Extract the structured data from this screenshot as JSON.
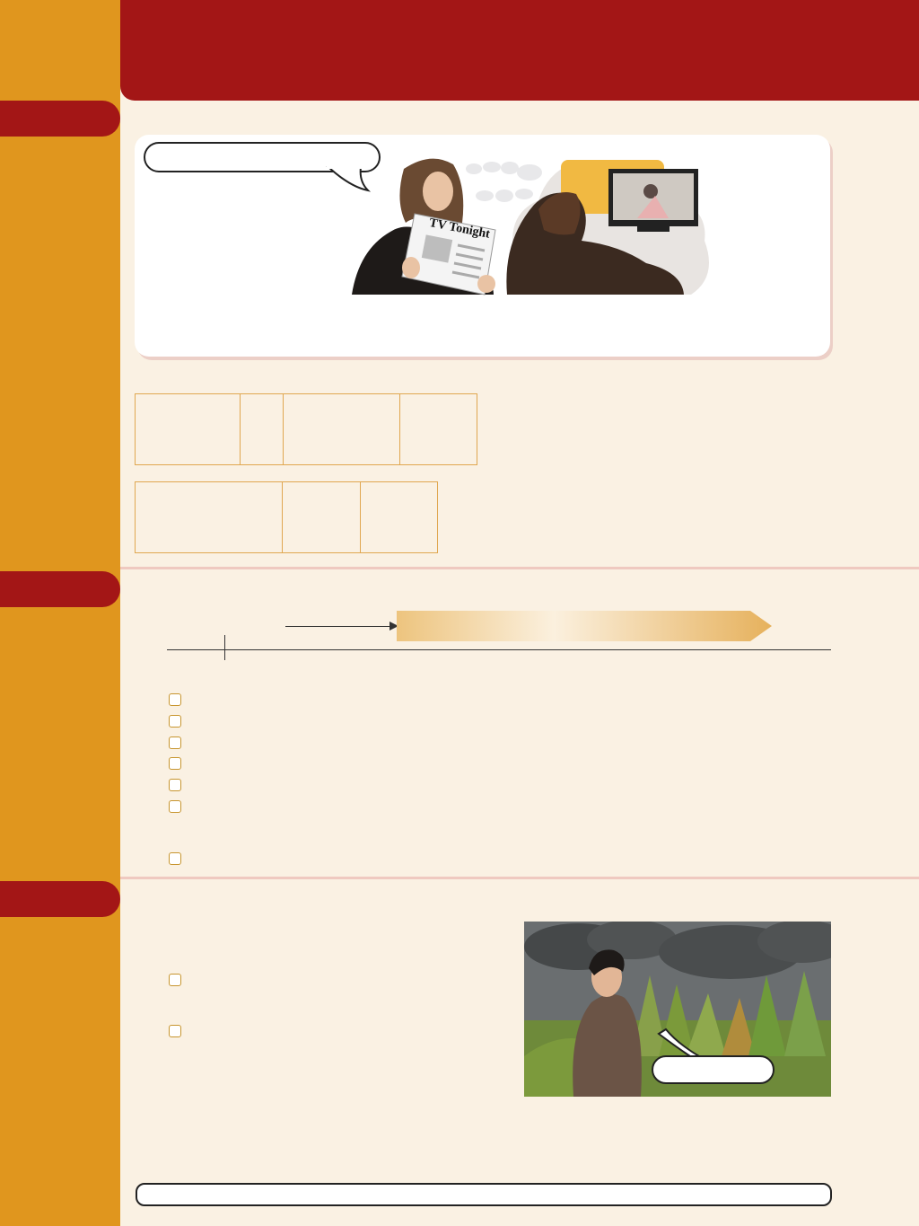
{
  "page": {
    "colors": {
      "header": "#a31616",
      "sidebar": "#e0961e",
      "background": "#faf1e3",
      "table_border": "#e0a750"
    }
  },
  "header": {
    "title": ""
  },
  "sections": [
    {
      "tab_label": ""
    },
    {
      "tab_label": ""
    },
    {
      "tab_label": ""
    }
  ],
  "illustration_top": {
    "newspaper_text": "TV Tonight",
    "icons": [
      "woman-reading-newspaper",
      "man-watching-tv",
      "thought-bubble"
    ]
  },
  "checklist_section2": [
    {
      "label": ""
    },
    {
      "label": ""
    },
    {
      "label": ""
    },
    {
      "label": ""
    },
    {
      "label": ""
    },
    {
      "label": ""
    },
    {
      "label": ""
    }
  ],
  "checklist_section3": [
    {
      "label": ""
    },
    {
      "label": ""
    }
  ],
  "illustration_bottom": {
    "icons": [
      "man-in-rain",
      "storm-clouds",
      "speech-bubble"
    ]
  }
}
